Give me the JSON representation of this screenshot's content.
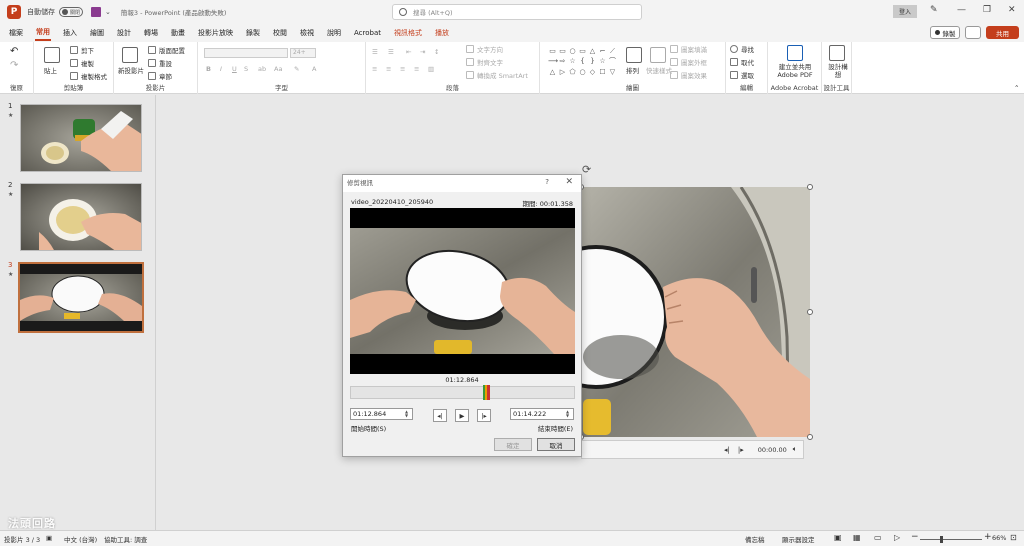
{
  "titlebar": {
    "autosave_label": "自動儲存",
    "autosave_state": "關閉",
    "doc_title": "簡報3 - PowerPoint (產品啟動失敗)",
    "search_placeholder": "搜尋 (Alt+Q)",
    "login_label": "登入"
  },
  "tabs": [
    {
      "label": "檔案"
    },
    {
      "label": "常用"
    },
    {
      "label": "插入"
    },
    {
      "label": "繪圖"
    },
    {
      "label": "設計"
    },
    {
      "label": "轉場"
    },
    {
      "label": "動畫"
    },
    {
      "label": "投影片放映"
    },
    {
      "label": "錄製"
    },
    {
      "label": "校閱"
    },
    {
      "label": "檢視"
    },
    {
      "label": "說明"
    },
    {
      "label": "Acrobat"
    },
    {
      "label": "視訊格式"
    },
    {
      "label": "播放"
    }
  ],
  "tab_actions": {
    "record": "錄製",
    "share": "共用"
  },
  "ribbon": {
    "undo_group": "復原",
    "clipboard": {
      "label": "剪貼簿",
      "paste": "貼上",
      "cut": "剪下",
      "copy": "複製",
      "format_painter": "複製格式"
    },
    "slides": {
      "label": "投影片",
      "new_slide": "新投影片",
      "layout": "版面配置",
      "reset": "重設",
      "section": "章節"
    },
    "font": {
      "label": "字型",
      "size": "24+",
      "bold": "B",
      "italic": "I",
      "underline": "U",
      "strike": "S"
    },
    "paragraph": {
      "label": "段落",
      "text_direction": "文字方向",
      "align_text": "對齊文字",
      "smartart": "轉換成 SmartArt"
    },
    "drawing": {
      "label": "繪圖",
      "arrange": "排列",
      "quick_styles": "快速樣式",
      "shape_fill": "圖案填滿",
      "shape_outline": "圖案外框",
      "shape_effects": "圖案效果"
    },
    "editing": {
      "label": "編輯",
      "find": "尋找",
      "replace": "取代",
      "select": "選取"
    },
    "acrobat": {
      "label": "Adobe Acrobat",
      "create_pdf": "建立並共用 Adobe PDF"
    },
    "designer": {
      "label": "設計工具",
      "design_ideas": "設計構想"
    }
  },
  "slides": [
    {
      "num": "1",
      "star": "★",
      "active": false
    },
    {
      "num": "2",
      "star": "★",
      "active": false
    },
    {
      "num": "3",
      "star": "★",
      "active": true
    }
  ],
  "dialog": {
    "title": "修剪視訊",
    "help": "?",
    "close": "✕",
    "filename": "video_20220410_205940",
    "duration": "期間: 00:01.358",
    "current_time": "01:12.864",
    "start_time": "01:12.864",
    "end_time": "01:14.222",
    "start_label": "開始時間(S)",
    "end_label": "結束時間(E)",
    "ok": "確定",
    "cancel": "取消"
  },
  "player": {
    "time": "00:00.00"
  },
  "watermark": "法頭回路",
  "statusbar": {
    "slide_info": "投影片 3 / 3",
    "language": "中文 (台灣)",
    "accessibility": "協助工具: 調查",
    "notes": "備忘稿",
    "display_settings": "顯示器設定",
    "zoom": "66%"
  },
  "colors": {
    "accent": "#c43e1c",
    "selection": "#c0703e"
  }
}
